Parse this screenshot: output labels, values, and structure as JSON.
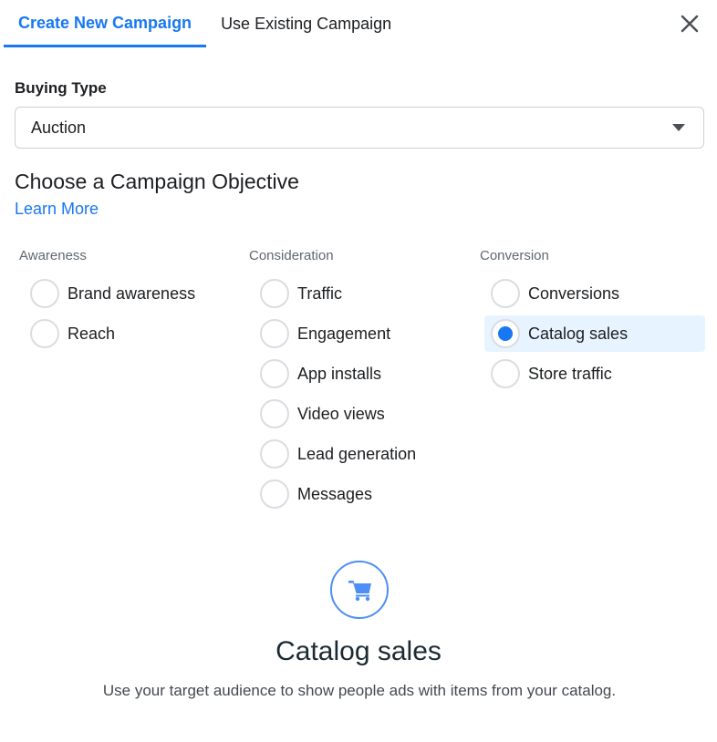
{
  "tabs": [
    {
      "label": "Create New Campaign",
      "active": true
    },
    {
      "label": "Use Existing Campaign",
      "active": false
    }
  ],
  "close_icon": "close-icon",
  "buying_type": {
    "label": "Buying Type",
    "value": "Auction",
    "icon": "caret-down-icon"
  },
  "objective": {
    "heading": "Choose a Campaign Objective",
    "learn_more": "Learn More",
    "accent_color": "#1877f2",
    "columns": [
      {
        "title": "Awareness",
        "options": [
          {
            "label": "Brand awareness",
            "selected": false
          },
          {
            "label": "Reach",
            "selected": false
          }
        ]
      },
      {
        "title": "Consideration",
        "options": [
          {
            "label": "Traffic",
            "selected": false
          },
          {
            "label": "Engagement",
            "selected": false
          },
          {
            "label": "App installs",
            "selected": false
          },
          {
            "label": "Video views",
            "selected": false
          },
          {
            "label": "Lead generation",
            "selected": false
          },
          {
            "label": "Messages",
            "selected": false
          }
        ]
      },
      {
        "title": "Conversion",
        "options": [
          {
            "label": "Conversions",
            "selected": false
          },
          {
            "label": "Catalog sales",
            "selected": true
          },
          {
            "label": "Store traffic",
            "selected": false
          }
        ]
      }
    ]
  },
  "detail": {
    "icon": "shopping-cart-icon",
    "title": "Catalog sales",
    "description": "Use your target audience to show people ads with items from your catalog."
  }
}
